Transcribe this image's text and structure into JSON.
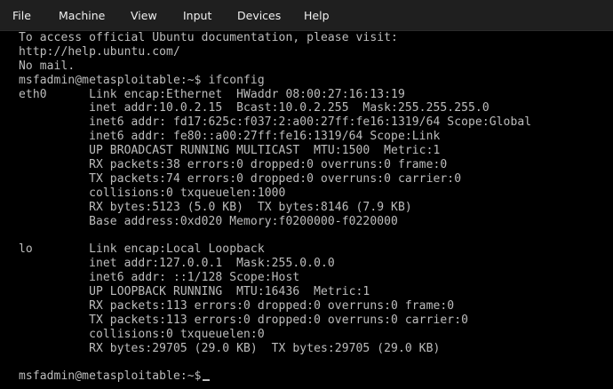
{
  "menu": {
    "file": "File",
    "machine": "Machine",
    "view": "View",
    "input": "Input",
    "devices": "Devices",
    "help": "Help"
  },
  "terminal": {
    "lines": [
      "To access official Ubuntu documentation, please visit:",
      "http://help.ubuntu.com/",
      "No mail.",
      "msfadmin@metasploitable:~$ ifconfig",
      "eth0      Link encap:Ethernet  HWaddr 08:00:27:16:13:19",
      "          inet addr:10.0.2.15  Bcast:10.0.2.255  Mask:255.255.255.0",
      "          inet6 addr: fd17:625c:f037:2:a00:27ff:fe16:1319/64 Scope:Global",
      "          inet6 addr: fe80::a00:27ff:fe16:1319/64 Scope:Link",
      "          UP BROADCAST RUNNING MULTICAST  MTU:1500  Metric:1",
      "          RX packets:38 errors:0 dropped:0 overruns:0 frame:0",
      "          TX packets:74 errors:0 dropped:0 overruns:0 carrier:0",
      "          collisions:0 txqueuelen:1000",
      "          RX bytes:5123 (5.0 KB)  TX bytes:8146 (7.9 KB)",
      "          Base address:0xd020 Memory:f0200000-f0220000",
      "",
      "lo        Link encap:Local Loopback",
      "          inet addr:127.0.0.1  Mask:255.0.0.0",
      "          inet6 addr: ::1/128 Scope:Host",
      "          UP LOOPBACK RUNNING  MTU:16436  Metric:1",
      "          RX packets:113 errors:0 dropped:0 overruns:0 frame:0",
      "          TX packets:113 errors:0 dropped:0 overruns:0 carrier:0",
      "          collisions:0 txqueuelen:0",
      "          RX bytes:29705 (29.0 KB)  TX bytes:29705 (29.0 KB)",
      "",
      "msfadmin@metasploitable:~$"
    ]
  },
  "colors": {
    "background": "#000000",
    "text": "#bdbdbd",
    "menubar": "#1f1f1f",
    "menu_text": "#f0f0f0"
  }
}
